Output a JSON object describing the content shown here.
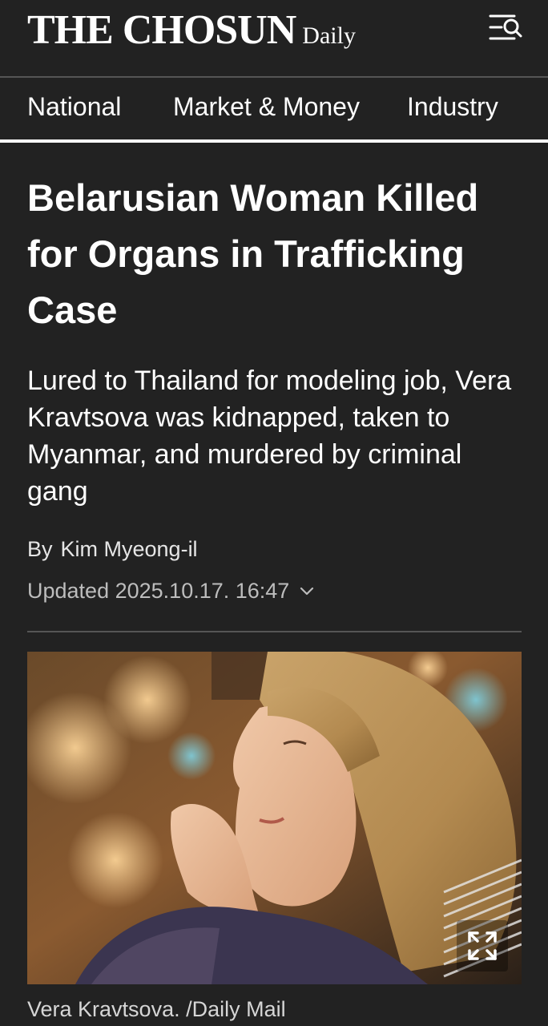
{
  "header": {
    "logo_main": "THE CHOSUN",
    "logo_sub": "Daily",
    "menu_icon": "search-menu-icon"
  },
  "nav": {
    "items": [
      {
        "label": "National"
      },
      {
        "label": "Market & Money"
      },
      {
        "label": "Industry"
      }
    ]
  },
  "article": {
    "headline": "Belarusian Woman Killed for Organs in Trafficking Case",
    "subheadline": "Lured to Thailand for modeling job, Vera Kravtsova was kidnapped, taken to Myanmar, and murdered by criminal gang",
    "byline_prefix": "By",
    "author": "Kim Myeong-il",
    "updated_label": "Updated",
    "updated_time": "2025.10.17. 16:47",
    "photo_caption": "Vera Kravtsova. /Daily Mail",
    "expand_icon": "expand-icon"
  },
  "colors": {
    "background": "#222222",
    "text": "#ffffff",
    "muted": "#bdbdbd",
    "divider": "#555555"
  }
}
